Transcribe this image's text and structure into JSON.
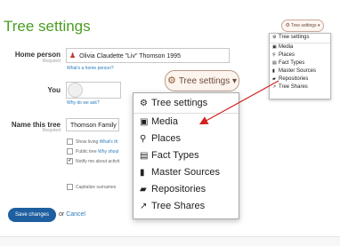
{
  "page": {
    "title": "Tree settings"
  },
  "small_dropdown": {
    "button_label": "Tree settings",
    "items": [
      {
        "icon": "gear-icon",
        "glyph": "⚙",
        "label": "Tree settings"
      },
      {
        "icon": "image-icon",
        "glyph": "▣",
        "label": "Media"
      },
      {
        "icon": "pin-icon",
        "glyph": "⚲",
        "label": "Places"
      },
      {
        "icon": "doc-icon",
        "glyph": "▤",
        "label": "Fact Types"
      },
      {
        "icon": "bookmark-icon",
        "glyph": "▮",
        "label": "Master Sources"
      },
      {
        "icon": "book-icon",
        "glyph": "▰",
        "label": "Repositories"
      },
      {
        "icon": "share-icon",
        "glyph": "↗",
        "label": "Tree Shares"
      }
    ]
  },
  "big_dropdown": {
    "button_label": "Tree settings",
    "items": [
      {
        "icon": "gear-icon",
        "glyph": "⚙",
        "label": "Tree settings"
      },
      {
        "icon": "image-icon",
        "glyph": "▣",
        "label": "Media"
      },
      {
        "icon": "pin-icon",
        "glyph": "⚲",
        "label": "Places"
      },
      {
        "icon": "doc-icon",
        "glyph": "▤",
        "label": "Fact Types"
      },
      {
        "icon": "bookmark-icon",
        "glyph": "▮",
        "label": "Master Sources"
      },
      {
        "icon": "book-icon",
        "glyph": "▰",
        "label": "Repositories"
      },
      {
        "icon": "share-icon",
        "glyph": "↗",
        "label": "Tree Shares"
      }
    ]
  },
  "form": {
    "home_person": {
      "label": "Home person",
      "required": "Required",
      "value": "Olivia Claudette \"Liv\" Thomson 1995",
      "help_link": "What's a home person?"
    },
    "you": {
      "label": "You",
      "help_link": "Why do we ask?"
    },
    "tree_name": {
      "label": "Name this tree",
      "required": "Required",
      "value": "Thomson Family Tr"
    },
    "options": [
      {
        "text": "Show living ",
        "link": "What's th",
        "checked": false
      },
      {
        "text": "Public tree ",
        "link": "Why shoul",
        "checked": false
      },
      {
        "text": "Notify me about activit",
        "link": "",
        "checked": true
      }
    ],
    "capitalize": {
      "text": "Capitalize surnames",
      "checked": false
    }
  },
  "actions": {
    "save": "Save changes",
    "or": "or",
    "cancel": "Cancel"
  },
  "colors": {
    "title": "#4a9d23",
    "save_button": "#1e5fa0",
    "link": "#2a7ab8",
    "arrow": "#d42020"
  }
}
